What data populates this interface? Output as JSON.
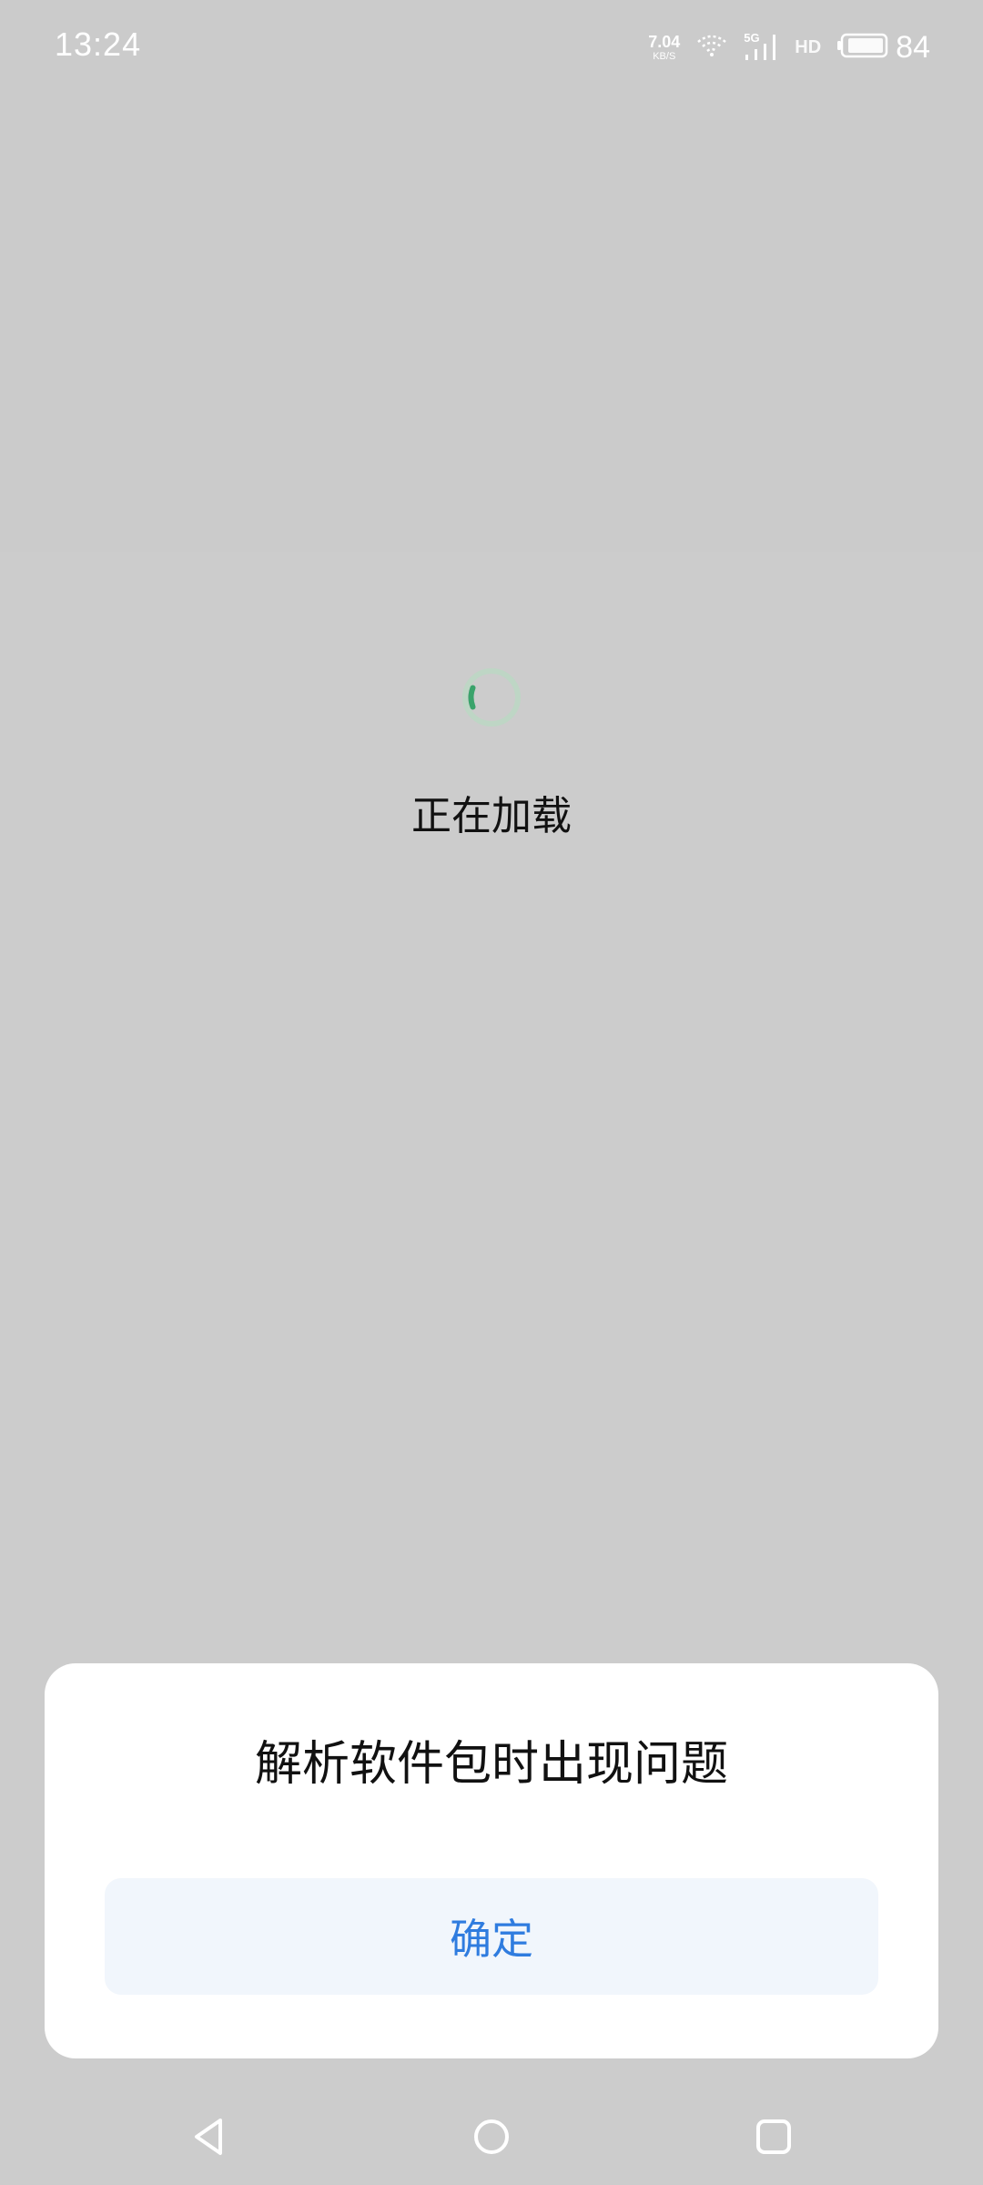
{
  "status_bar": {
    "time": "13:24",
    "net_speed_value": "7.04",
    "net_speed_unit": "KB/S",
    "network_type": "5G",
    "hd_label": "HD",
    "battery_percent": "84",
    "icons": [
      "wifi-icon",
      "signal-icon",
      "battery-icon"
    ]
  },
  "loading": {
    "text": "正在加载",
    "spinner_accent": "#3aa36b"
  },
  "dialog": {
    "title": "解析软件包时出现问题",
    "confirm_label": "确定",
    "confirm_color": "#2f7cdf"
  },
  "nav_bar": {
    "icons": [
      "back-icon",
      "home-icon",
      "recents-icon"
    ]
  }
}
